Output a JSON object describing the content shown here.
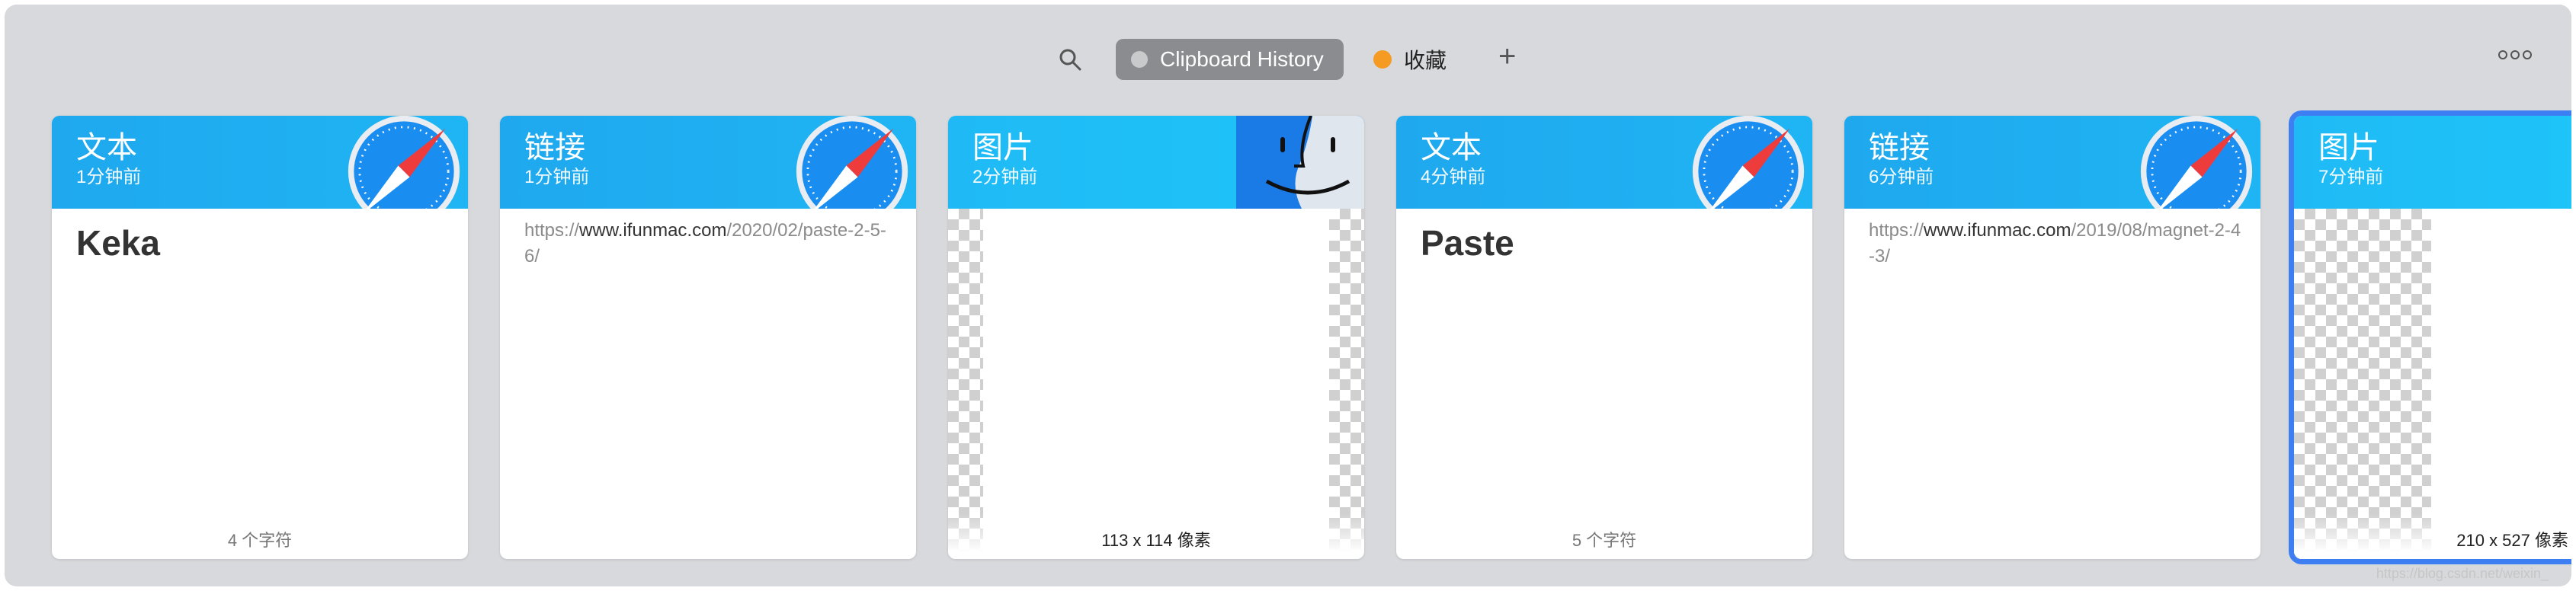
{
  "toolbar": {
    "search_icon": "search-icon",
    "active_pinboard": "Clipboard History",
    "favorites_label": "收藏",
    "add_icon": "plus-icon",
    "more_icon": "more-icon",
    "colors": {
      "pill": "#8a8c90",
      "favorite_dot": "#f59a23"
    }
  },
  "cards": [
    {
      "type_label": "文本",
      "time_label": "1分钟前",
      "content": "Keka",
      "footer": "4 个字符",
      "icon": "safari-icon"
    },
    {
      "type_label": "链接",
      "time_label": "1分钟前",
      "link_prefix": "https://",
      "link_host": "www.ifunmac.com",
      "link_path": "/2020/02/paste-2-5-6/",
      "icon": "safari-icon"
    },
    {
      "type_label": "图片",
      "time_label": "2分钟前",
      "footer": "113 x 114 像素",
      "icon": "finder-icon"
    },
    {
      "type_label": "文本",
      "time_label": "4分钟前",
      "content": "Paste",
      "footer": "5 个字符",
      "icon": "safari-icon"
    },
    {
      "type_label": "链接",
      "time_label": "6分钟前",
      "link_prefix": "https://",
      "link_host": "www.ifunmac.com",
      "link_path": "/2019/08/magnet-2-4-3/",
      "icon": "safari-icon"
    },
    {
      "type_label": "图片",
      "time_label": "7分钟前",
      "footer": "210 x 527 像素",
      "selected": true
    }
  ],
  "watermark": "https://blog.csdn.net/weixin_"
}
